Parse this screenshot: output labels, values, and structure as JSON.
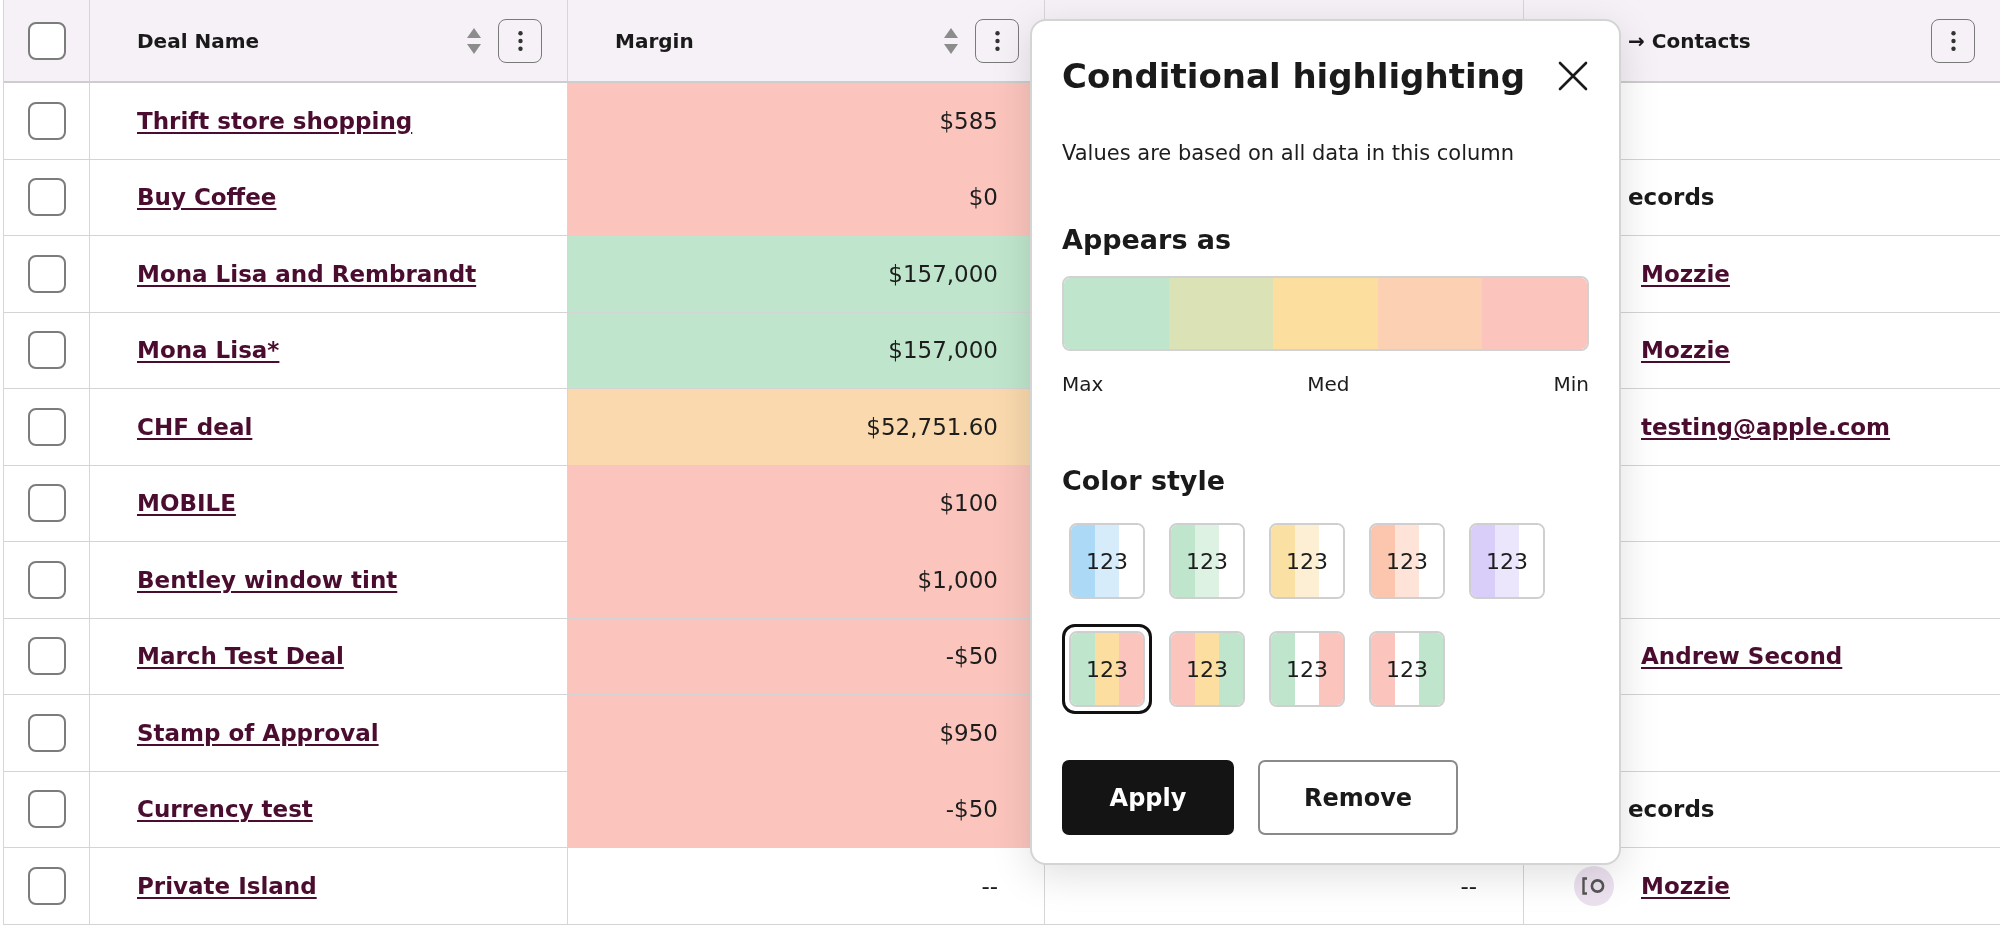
{
  "table": {
    "select_all": {
      "checked": false
    },
    "columns": [
      {
        "label": "Deal Name",
        "sortable": true
      },
      {
        "label": "Margin",
        "sortable": true
      },
      {},
      {
        "label": "→ Contacts",
        "sortable": false
      }
    ],
    "rows": [
      {
        "checked": false,
        "deal_name": "Thrift store shopping",
        "margin": {
          "value": "$585",
          "color": "#fbc5bd"
        }
      },
      {
        "checked": false,
        "deal_name": "Buy Coffee",
        "margin": {
          "value": "$0",
          "color": "#fbc5bd"
        },
        "contacts": {
          "kind": "text",
          "text": "ecords"
        }
      },
      {
        "checked": false,
        "deal_name": "Mona Lisa and Rembrandt",
        "margin": {
          "value": "$157,000",
          "color": "#bfe6cc"
        },
        "contacts": {
          "kind": "link",
          "text": "Mozzie"
        }
      },
      {
        "checked": false,
        "deal_name": "Mona Lisa*",
        "margin": {
          "value": "$157,000",
          "color": "#bfe6cc"
        },
        "contacts": {
          "kind": "link",
          "text": "Mozzie"
        }
      },
      {
        "checked": false,
        "deal_name": "CHF deal",
        "margin": {
          "value": "$52,751.60",
          "color": "#f9d9ad"
        },
        "contacts": {
          "kind": "link",
          "text": "testing@apple.com"
        }
      },
      {
        "checked": false,
        "deal_name": "MOBILE",
        "margin": {
          "value": "$100",
          "color": "#fbc5bd"
        }
      },
      {
        "checked": false,
        "deal_name": "Bentley window tint",
        "margin": {
          "value": "$1,000",
          "color": "#fbc5bd"
        }
      },
      {
        "checked": false,
        "deal_name": "March Test Deal",
        "margin": {
          "value": "-$50",
          "color": "#fbc5bd"
        },
        "contacts": {
          "kind": "link",
          "text": "Andrew Second"
        }
      },
      {
        "checked": false,
        "deal_name": "Stamp of Approval",
        "margin": {
          "value": "$950",
          "color": "#fbc5bd"
        }
      },
      {
        "checked": false,
        "deal_name": "Currency test",
        "margin": {
          "value": "-$50",
          "color": "#fbc5bd"
        },
        "contacts": {
          "kind": "text",
          "text": "ecords"
        }
      },
      {
        "checked": false,
        "deal_name": "Private Island",
        "margin": {
          "value": "--"
        },
        "column_3": "--",
        "contacts": {
          "kind": "link",
          "text": "Mozzie",
          "avatar": true
        }
      }
    ]
  },
  "highlight_panel": {
    "title": "Conditional highlighting",
    "description": "Values are based on all data in this column",
    "appears_as": {
      "heading": "Appears as",
      "segments": [
        {
          "color": "#bfe6cc"
        },
        {
          "color": "#dbe2b6"
        },
        {
          "color": "#fcdf9f"
        },
        {
          "color": "#fcd0b2"
        },
        {
          "color": "#fbc5be"
        }
      ],
      "labels": [
        "Max",
        "Med",
        "Min"
      ]
    },
    "color_style": {
      "heading": "Color style",
      "options": [
        {
          "label": "123",
          "selected": false,
          "stripes": [
            {
              "color": "#acd9f5"
            },
            {
              "color": "#d6ecfb"
            },
            {
              "color": "#ffffff"
            }
          ]
        },
        {
          "label": "123",
          "selected": false,
          "stripes": [
            {
              "color": "#bfe6cc"
            },
            {
              "color": "#def2e4"
            },
            {
              "color": "#ffffff"
            }
          ]
        },
        {
          "label": "123",
          "selected": false,
          "stripes": [
            {
              "color": "#fbe0a3"
            },
            {
              "color": "#fdefd4"
            },
            {
              "color": "#ffffff"
            }
          ]
        },
        {
          "label": "123",
          "selected": false,
          "stripes": [
            {
              "color": "#fcc5ad"
            },
            {
              "color": "#fee3d9"
            },
            {
              "color": "#ffffff"
            }
          ]
        },
        {
          "label": "123",
          "selected": false,
          "stripes": [
            {
              "color": "#d9cdf9"
            },
            {
              "color": "#ece6fc"
            },
            {
              "color": "#ffffff"
            }
          ]
        },
        {
          "label": "123",
          "selected": true,
          "stripes": [
            {
              "color": "#bfe6cc"
            },
            {
              "color": "#fbdea0"
            },
            {
              "color": "#fbc5be"
            }
          ]
        },
        {
          "label": "123",
          "selected": false,
          "stripes": [
            {
              "color": "#fbc5be"
            },
            {
              "color": "#fbdea0"
            },
            {
              "color": "#bfe6cc"
            }
          ]
        },
        {
          "label": "123",
          "selected": false,
          "stripes": [
            {
              "color": "#bfe6cc"
            },
            {
              "color": "#ffffff"
            },
            {
              "color": "#fbc5be"
            }
          ]
        },
        {
          "label": "123",
          "selected": false,
          "stripes": [
            {
              "color": "#fbc5be"
            },
            {
              "color": "#ffffff"
            },
            {
              "color": "#bfe6cc"
            }
          ]
        }
      ]
    },
    "buttons": [
      {
        "label": "Apply",
        "kind": "primary"
      },
      {
        "label": "Remove",
        "kind": "secondary"
      }
    ]
  }
}
